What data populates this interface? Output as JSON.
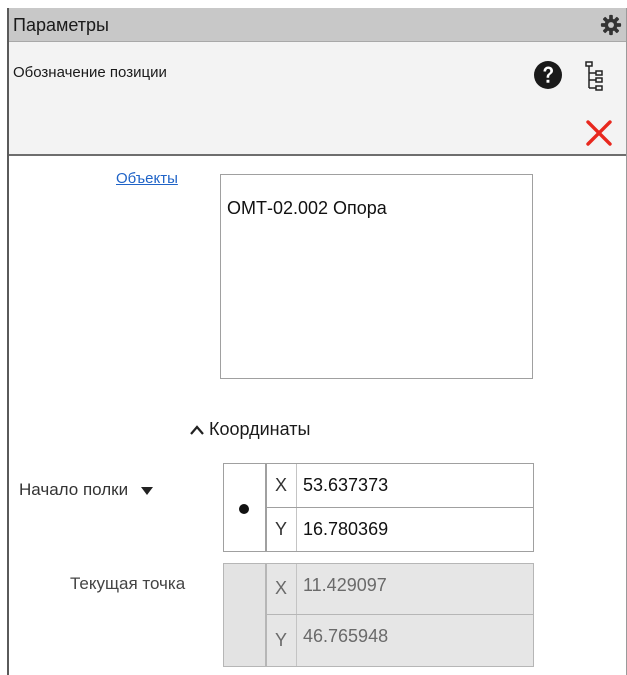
{
  "panel": {
    "title": "Параметры",
    "command_name": "Обозначение позиции"
  },
  "icons": {
    "settings": "gear-icon",
    "help": "question-circle-icon",
    "tree": "tree-structure-icon",
    "close": "close-x-icon"
  },
  "colors": {
    "accent_link": "#1f63c7",
    "close_red": "#e8281e",
    "titlebar": "#c8c8c8",
    "header_bg": "#f3f3f3"
  },
  "objects": {
    "label": "Объекты",
    "items": [
      "ОМТ-02.002 Опора"
    ]
  },
  "coordinates": {
    "section_title": "Координаты",
    "start_label": "Начало полки",
    "start": {
      "x_axis": "X",
      "x_value": "53.637373",
      "y_axis": "Y",
      "y_value": "16.780369"
    },
    "current_label": "Текущая точка",
    "current": {
      "x_axis": "X",
      "x_value": "11.429097",
      "y_axis": "Y",
      "y_value": "46.765948"
    }
  }
}
